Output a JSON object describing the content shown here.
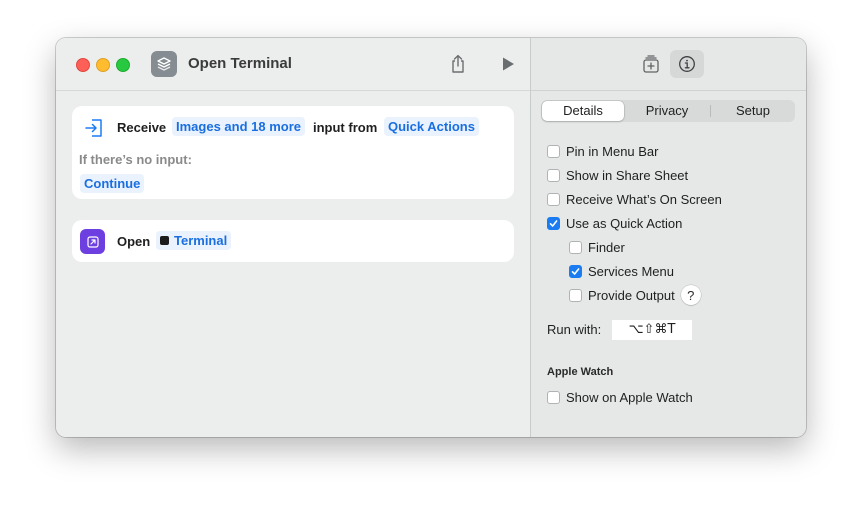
{
  "window": {
    "title": "Open Terminal"
  },
  "actions": {
    "receive": {
      "label": "Receive",
      "types_token": "Images and 18 more",
      "from_label": "input from",
      "source_token": "Quick Actions",
      "no_input_label": "If there’s no input:",
      "no_input_token": "Continue"
    },
    "open": {
      "label": "Open",
      "app_token": "Terminal"
    }
  },
  "inspector": {
    "tabs": [
      "Details",
      "Privacy",
      "Setup"
    ],
    "selected_tab": "Details",
    "options": {
      "pin_menu_bar": {
        "label": "Pin in Menu Bar",
        "checked": false
      },
      "share_sheet": {
        "label": "Show in Share Sheet",
        "checked": false
      },
      "receive_screen": {
        "label": "Receive What’s On Screen",
        "checked": false
      },
      "quick_action": {
        "label": "Use as Quick Action",
        "checked": true
      },
      "finder": {
        "label": "Finder",
        "checked": false
      },
      "services_menu": {
        "label": "Services Menu",
        "checked": true
      },
      "provide_output": {
        "label": "Provide Output",
        "checked": false
      }
    },
    "help_label": "?",
    "run_with_label": "Run with:",
    "shortcut": "⌥⇧⌘T",
    "apple_watch": {
      "heading": "Apple Watch",
      "show_label": "Show on Apple Watch",
      "checked": false
    }
  },
  "icons": {
    "app": "shortcuts-layers-icon",
    "share": "share-icon",
    "run": "play-icon",
    "library": "add-to-library-icon",
    "info": "info-icon",
    "receive": "receive-input-icon",
    "open": "open-app-icon"
  },
  "colors": {
    "accent": "#1b7cf2",
    "token_text": "#1a6fe0",
    "open_action": "#6e3fe0"
  }
}
